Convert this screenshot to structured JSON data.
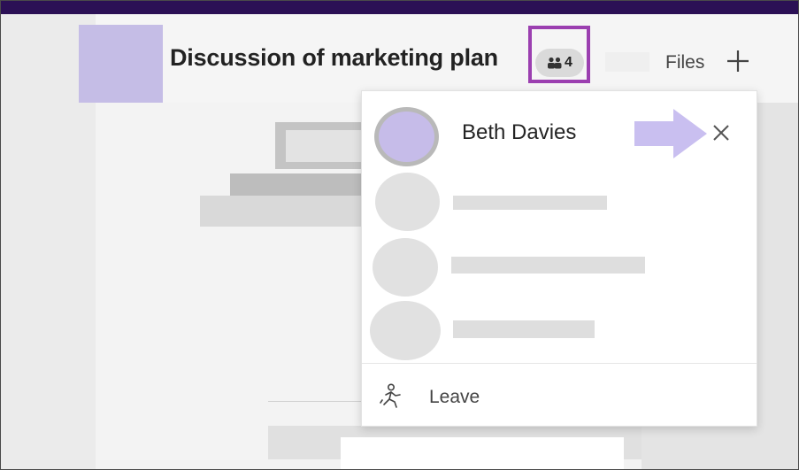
{
  "header": {
    "title": "Discussion of marketing plan",
    "participant_count": "4",
    "people_icon": "people-icon",
    "files_tab_label": "Files",
    "add_tab_icon": "plus-icon"
  },
  "colors": {
    "top_bar": "#2b1055",
    "highlight_border": "#9b3fb0",
    "accent_avatar": "#c5bde6",
    "arrow": "#c9bff0"
  },
  "people_popup": {
    "members": [
      {
        "name": "Beth Davies",
        "has_remove_button": true
      },
      {
        "name": ""
      },
      {
        "name": ""
      },
      {
        "name": ""
      }
    ],
    "remove_icon": "close-icon",
    "pointer_icon": "arrow-right-icon",
    "leave_label": "Leave",
    "leave_icon": "leave-person-icon"
  }
}
